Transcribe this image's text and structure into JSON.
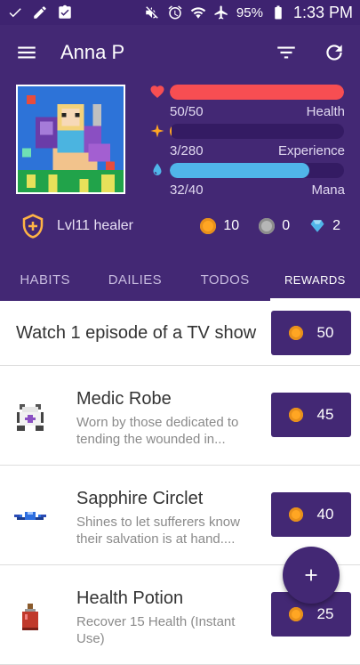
{
  "status_bar": {
    "battery": "95%",
    "time": "1:33 PM"
  },
  "app_bar": {
    "title": "Anna P",
    "icons": [
      "menu-icon",
      "filter-icon",
      "refresh-icon"
    ]
  },
  "stats": {
    "health": {
      "value": "50/50",
      "label": "Health",
      "fraction": 1.0,
      "color": "#f74e52"
    },
    "experience": {
      "value": "3/280",
      "label": "Experience",
      "fraction": 0.011,
      "color": "#ffa623"
    },
    "mana": {
      "value": "32/40",
      "label": "Mana",
      "fraction": 0.8,
      "color": "#50b5e9"
    }
  },
  "profile": {
    "class_text": "Lvl11 healer",
    "gold": "10",
    "silver": "0",
    "gems": "2"
  },
  "tabs": [
    {
      "label": "HABITS",
      "active": false
    },
    {
      "label": "DAILIES",
      "active": false
    },
    {
      "label": "TODOS",
      "active": false
    },
    {
      "label": "REWARDS",
      "active": true
    }
  ],
  "rewards": [
    {
      "title": "Watch 1 episode of a TV show",
      "price": "50",
      "type": "custom"
    },
    {
      "title": "Medic Robe",
      "description": "Worn by those dedicated to tending the wounded in...",
      "price": "45",
      "type": "gear",
      "icon": "robe-icon"
    },
    {
      "title": "Sapphire Circlet",
      "description": "Shines to let sufferers know their salvation is at hand....",
      "price": "40",
      "type": "gear",
      "icon": "circlet-icon"
    },
    {
      "title": "Health Potion",
      "description": "Recover 15 Health (Instant Use)",
      "price": "25",
      "type": "gear",
      "icon": "potion-icon"
    }
  ],
  "fab": {
    "icon": "plus-icon"
  }
}
